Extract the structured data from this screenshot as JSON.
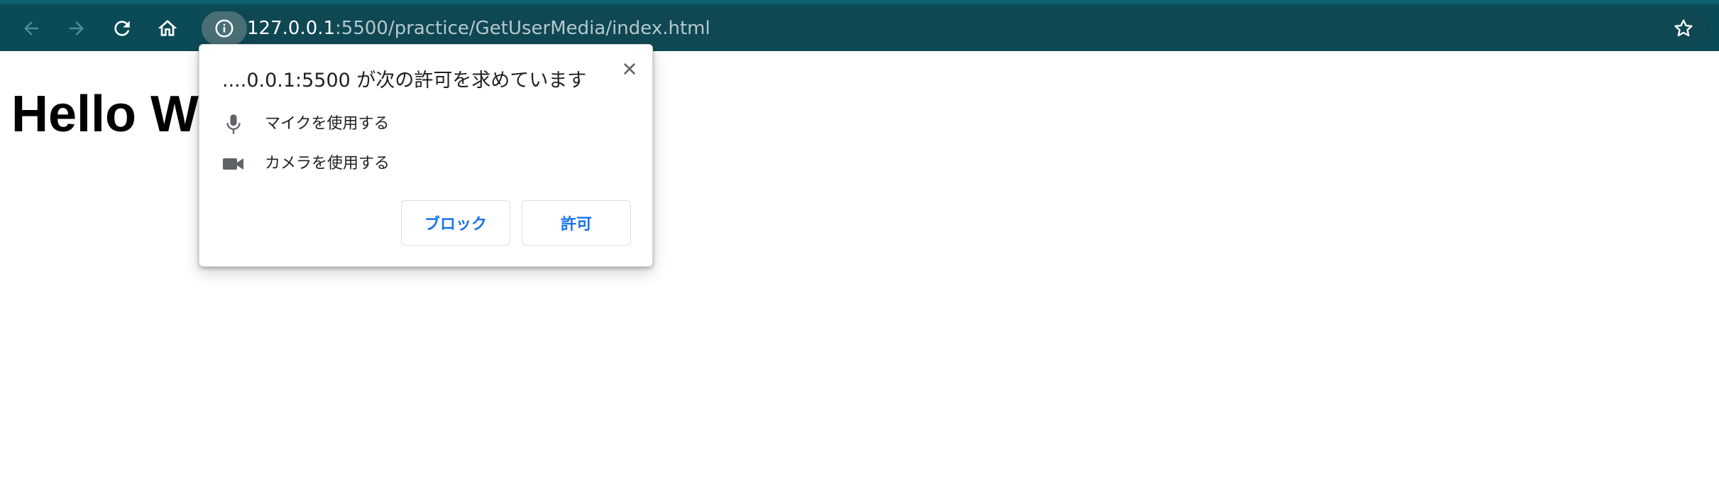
{
  "browser": {
    "url_host": "127.0.0.1",
    "url_rest": ":5500/practice/GetUserMedia/index.html",
    "icons": {
      "back": "arrow-left-icon",
      "forward": "arrow-right-icon",
      "reload": "reload-icon",
      "home": "home-icon",
      "site_info": "info-icon",
      "bookmark": "star-icon"
    }
  },
  "page": {
    "heading": "Hello World"
  },
  "permission_popup": {
    "title": "....0.0.1:5500 が次の許可を求めています",
    "permissions": [
      {
        "icon": "microphone-icon",
        "label": "マイクを使用する"
      },
      {
        "icon": "camera-icon",
        "label": "カメラを使用する"
      }
    ],
    "block_label": "ブロック",
    "allow_label": "許可",
    "close_icon": "close-icon"
  },
  "colors": {
    "toolbar_bg": "#0b4a57",
    "omnibox_bg": "#0f4753",
    "button_text": "#1a73e8"
  }
}
